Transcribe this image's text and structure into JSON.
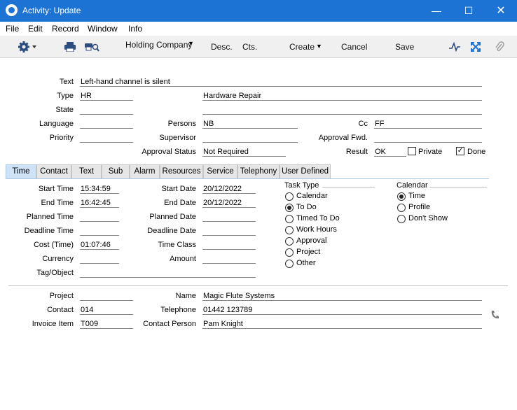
{
  "window": {
    "title": "Activity: Update"
  },
  "menu": [
    "File",
    "Edit",
    "Record",
    "Window",
    "Info"
  ],
  "toolbar": {
    "company": "Holding Company",
    "desc": "Desc.",
    "cts": "Cts.",
    "create": "Create",
    "cancel": "Cancel",
    "save": "Save"
  },
  "header": {
    "text_label": "Text",
    "text_value": "Left-hand channel is silent",
    "type_label": "Type",
    "type_value": "HR",
    "type_desc": "Hardware Repair",
    "state_label": "State",
    "state_value": "",
    "state_desc": "",
    "language_label": "Language",
    "language_value": "",
    "persons_label": "Persons",
    "persons_value": "NB",
    "cc_label": "Cc",
    "cc_value": "FF",
    "priority_label": "Priority",
    "priority_value": "",
    "supervisor_label": "Supervisor",
    "supervisor_value": "",
    "approval_fwd_label": "Approval Fwd.",
    "approval_fwd_value": "",
    "approval_status_label": "Approval Status",
    "approval_status_value": "Not Required",
    "result_label": "Result",
    "result_value": "OK",
    "private_label": "Private",
    "private_checked": false,
    "done_label": "Done",
    "done_checked": true
  },
  "tabs": [
    "Time",
    "Contact",
    "Text",
    "Sub",
    "Alarm",
    "Resources",
    "Service",
    "Telephony",
    "User Defined"
  ],
  "active_tab": "Time",
  "time_tab": {
    "start_time_label": "Start Time",
    "start_time": "15:34:59",
    "start_date_label": "Start Date",
    "start_date": "20/12/2022",
    "end_time_label": "End Time",
    "end_time": "16:42:45",
    "end_date_label": "End Date",
    "end_date": "20/12/2022",
    "planned_time_label": "Planned Time",
    "planned_time": "",
    "planned_date_label": "Planned Date",
    "planned_date": "",
    "deadline_time_label": "Deadline Time",
    "deadline_time": "",
    "deadline_date_label": "Deadline Date",
    "deadline_date": "",
    "cost_time_label": "Cost (Time)",
    "cost_time": "01:07:46",
    "time_class_label": "Time Class",
    "time_class": "",
    "currency_label": "Currency",
    "currency": "",
    "amount_label": "Amount",
    "amount": "",
    "tag_label": "Tag/Object",
    "tag": "",
    "task_type_label": "Task Type",
    "task_types": [
      "Calendar",
      "To Do",
      "Timed To Do",
      "Work Hours",
      "Approval",
      "Project",
      "Other"
    ],
    "task_type_selected": "To Do",
    "calendar_label": "Calendar",
    "calendar_options": [
      "Time",
      "Profile",
      "Don't Show"
    ],
    "calendar_selected": "Time"
  },
  "footer": {
    "project_label": "Project",
    "project_value": "",
    "name_label": "Name",
    "name_value": "Magic Flute Systems",
    "contact_label": "Contact",
    "contact_value": "014",
    "telephone_label": "Telephone",
    "telephone_value": "01442 123789",
    "invoice_item_label": "Invoice Item",
    "invoice_item_value": "T009",
    "contact_person_label": "Contact Person",
    "contact_person_value": "Pam Knight"
  },
  "colors": {
    "titlebar": "#1d73d3",
    "active_tab": "#cfe3f7",
    "toolbar": "#f0f0f0"
  }
}
